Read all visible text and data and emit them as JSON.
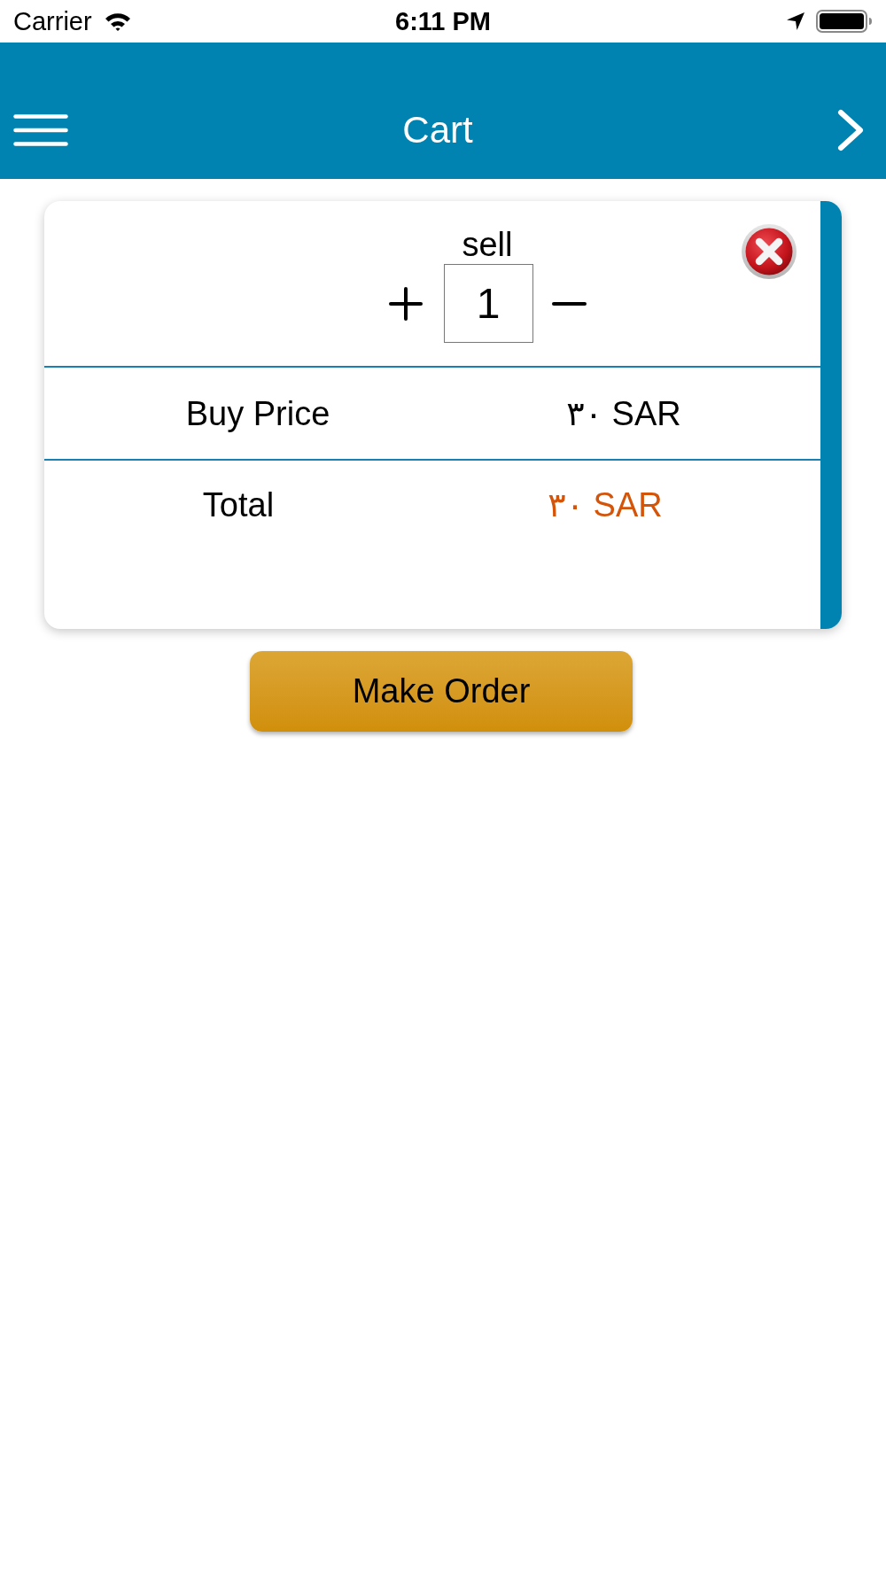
{
  "status_bar": {
    "carrier": "Carrier",
    "time": "6:11 PM"
  },
  "header": {
    "title": "Cart"
  },
  "cart_items": [
    {
      "quantity_label": "sell",
      "quantity": "1",
      "rows": [
        {
          "kind": "price",
          "label": "Buy Price",
          "value": "٣٠ SAR"
        },
        {
          "kind": "total",
          "label": "Total",
          "value": "٣٠ SAR"
        }
      ]
    }
  ],
  "order_button": {
    "label": "Make Order"
  }
}
